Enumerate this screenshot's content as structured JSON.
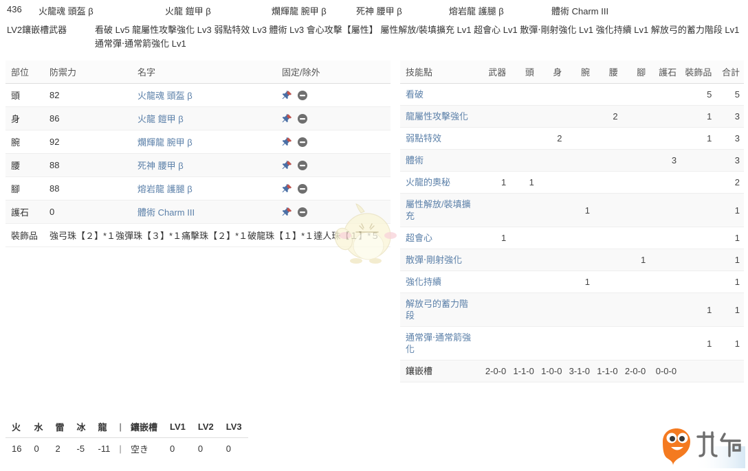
{
  "summary": {
    "attack": "436",
    "pieces": [
      "火龍魂 頭盔 β",
      "火龍 鎧甲 β",
      "爛輝龍 腕甲 β",
      "死神 腰甲 β",
      "熔岩龍 護腿 β",
      "體術 Charm III"
    ],
    "weapon_label": "LV2鑲嵌槽武器",
    "skill_summary": "看破 Lv5 龍屬性攻擊強化 Lv3 弱點特效 Lv3 體術 Lv3 會心攻擊【屬性】 屬性解放/裝填擴充 Lv1 超會心 Lv1 散彈‧剛射強化 Lv1 強化持續 Lv1 解放弓的蓄力階段 Lv1 通常彈‧通常箭強化 Lv1"
  },
  "equip_table": {
    "headers": [
      "部位",
      "防禦力",
      "名字",
      "固定/除外"
    ],
    "rows": [
      {
        "part": "頭",
        "defense": "82",
        "name": "火龍魂 頭盔 β"
      },
      {
        "part": "身",
        "defense": "86",
        "name": "火龍 鎧甲 β"
      },
      {
        "part": "腕",
        "defense": "92",
        "name": "爛輝龍 腕甲 β"
      },
      {
        "part": "腰",
        "defense": "88",
        "name": "死神 腰甲 β"
      },
      {
        "part": "腳",
        "defense": "88",
        "name": "熔岩龍 護腿 β"
      },
      {
        "part": "護石",
        "defense": "0",
        "name": "體術 Charm III"
      }
    ],
    "deco_label": "裝飾品",
    "deco_list": "強弓珠【２】*１強彈珠【３】*１痛擊珠【２】*１破龍珠【１】*１達人珠【１】*５"
  },
  "skill_table": {
    "headers": [
      "技能點",
      "武器",
      "頭",
      "身",
      "腕",
      "腰",
      "腳",
      "護石",
      "裝飾品",
      "合計"
    ],
    "rows": [
      {
        "name": "看破",
        "weapon": "",
        "head": "",
        "body": "",
        "arms": "",
        "waist": "",
        "legs": "",
        "charm": "",
        "deco": "5",
        "total": "5"
      },
      {
        "name": "龍屬性攻擊強化",
        "weapon": "",
        "head": "",
        "body": "",
        "arms": "",
        "waist": "2",
        "legs": "",
        "charm": "",
        "deco": "1",
        "total": "3"
      },
      {
        "name": "弱點特效",
        "weapon": "",
        "head": "",
        "body": "2",
        "arms": "",
        "waist": "",
        "legs": "",
        "charm": "",
        "deco": "1",
        "total": "3"
      },
      {
        "name": "體術",
        "weapon": "",
        "head": "",
        "body": "",
        "arms": "",
        "waist": "",
        "legs": "",
        "charm": "3",
        "deco": "",
        "total": "3"
      },
      {
        "name": "火龍的奧秘",
        "weapon": "1",
        "head": "1",
        "body": "",
        "arms": "",
        "waist": "",
        "legs": "",
        "charm": "",
        "deco": "",
        "total": "2"
      },
      {
        "name": "屬性解放/裝填擴充",
        "weapon": "",
        "head": "",
        "body": "",
        "arms": "1",
        "waist": "",
        "legs": "",
        "charm": "",
        "deco": "",
        "total": "1"
      },
      {
        "name": "超會心",
        "weapon": "1",
        "head": "",
        "body": "",
        "arms": "",
        "waist": "",
        "legs": "",
        "charm": "",
        "deco": "",
        "total": "1"
      },
      {
        "name": "散彈‧剛射強化",
        "weapon": "",
        "head": "",
        "body": "",
        "arms": "",
        "waist": "",
        "legs": "1",
        "charm": "",
        "deco": "",
        "total": "1"
      },
      {
        "name": "強化持續",
        "weapon": "",
        "head": "",
        "body": "",
        "arms": "1",
        "waist": "",
        "legs": "",
        "charm": "",
        "deco": "",
        "total": "1"
      },
      {
        "name": "解放弓的蓄力階段",
        "weapon": "",
        "head": "",
        "body": "",
        "arms": "",
        "waist": "",
        "legs": "",
        "charm": "",
        "deco": "1",
        "total": "1"
      },
      {
        "name": "通常彈‧通常箭強化",
        "weapon": "",
        "head": "",
        "body": "",
        "arms": "",
        "waist": "",
        "legs": "",
        "charm": "",
        "deco": "1",
        "total": "1"
      }
    ],
    "slot_row": {
      "name": "鑲嵌槽",
      "weapon": "2-0-0",
      "head": "1-1-0",
      "body": "1-0-0",
      "arms": "3-1-0",
      "waist": "1-1-0",
      "legs": "2-0-0",
      "charm": "0-0-0",
      "deco": "",
      "total": ""
    }
  },
  "resist_table": {
    "headers": [
      "火",
      "水",
      "雷",
      "冰",
      "龍",
      "|",
      "鑲嵌槽",
      "LV1",
      "LV2",
      "LV3"
    ],
    "values": [
      "16",
      "0",
      "2",
      "-5",
      "-11",
      "|",
      "空き",
      "0",
      "0",
      "0"
    ]
  },
  "icons": {
    "pin": "pin-icon",
    "exclude": "minus-circle-icon"
  },
  "watermarks": {
    "logo_text": "九游",
    "chick": "chick-watermark"
  },
  "colors": {
    "link": "#5a7fa8",
    "logo_orange": "#f37021",
    "pin_blue": "#4a6fa5",
    "pin_red": "#c4534a",
    "border": "#dddddd"
  }
}
